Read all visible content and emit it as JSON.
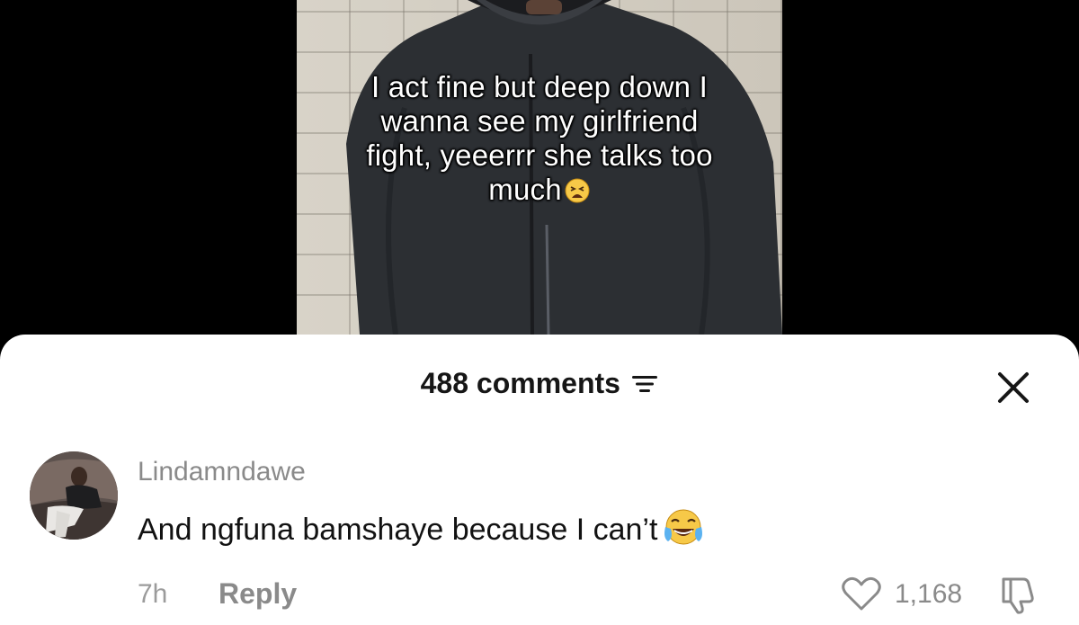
{
  "video": {
    "caption_lines": [
      "I act fine but deep down I",
      "wanna see my girlfriend",
      "fight, yeeerrr she talks too",
      "much"
    ],
    "caption_emoji": "weary-face-emoji"
  },
  "comments_panel": {
    "count_label": "488 comments",
    "sort_icon": "sort-lines-icon",
    "close_icon": "close-x-icon"
  },
  "comment": {
    "username": "Lindamndawe",
    "text": "And ngfuna bamshaye because I can’t",
    "emoji": "face-with-tears-of-joy-emoji",
    "time": "7h",
    "reply_label": "Reply",
    "like_count": "1,168",
    "like_icon": "heart-icon",
    "dislike_icon": "thumbs-down-icon"
  },
  "colors": {
    "sheet_bg": "#ffffff",
    "background": "#000000",
    "muted_text": "#8a8a8a",
    "primary_text": "#161616"
  }
}
